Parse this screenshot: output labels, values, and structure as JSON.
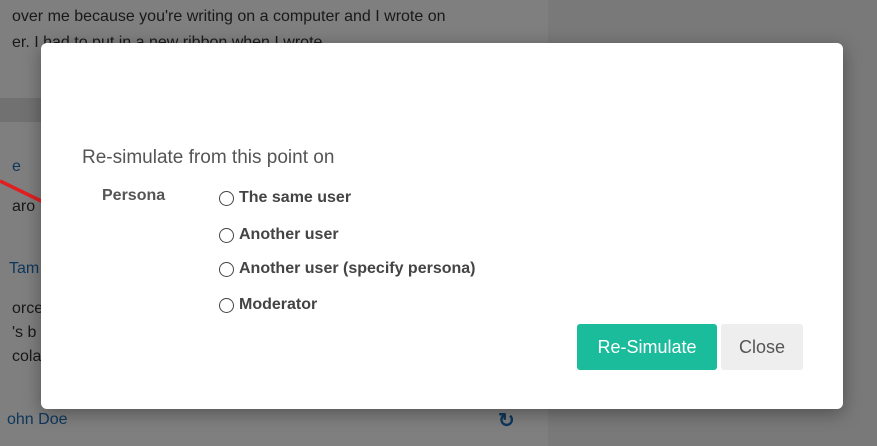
{
  "background": {
    "message_line1": "over me because you're writing on a computer and I wrote on",
    "message_line2": "er. I had to put in a new ribbon when I wrote",
    "name_1": "e",
    "text_1": "aro",
    "name_2": "Tam",
    "text_2a": "orce",
    "text_2b": "'s b",
    "text_2c": "cola",
    "name_3": "ohn Doe",
    "refresh_icon": "refresh-icon"
  },
  "modal": {
    "title": "Re-simulate from this point on",
    "persona_label": "Persona",
    "options": [
      {
        "label": "The same user"
      },
      {
        "label": "Another user"
      },
      {
        "label": "Another user (specify persona)"
      },
      {
        "label": "Moderator"
      }
    ],
    "resimulate_label": "Re-Simulate",
    "close_label": "Close"
  },
  "colors": {
    "primary_button": "#1abc9c",
    "secondary_button": "#eeeeee",
    "link": "#1d6fb8",
    "annotation_arrow": "#e02020"
  }
}
